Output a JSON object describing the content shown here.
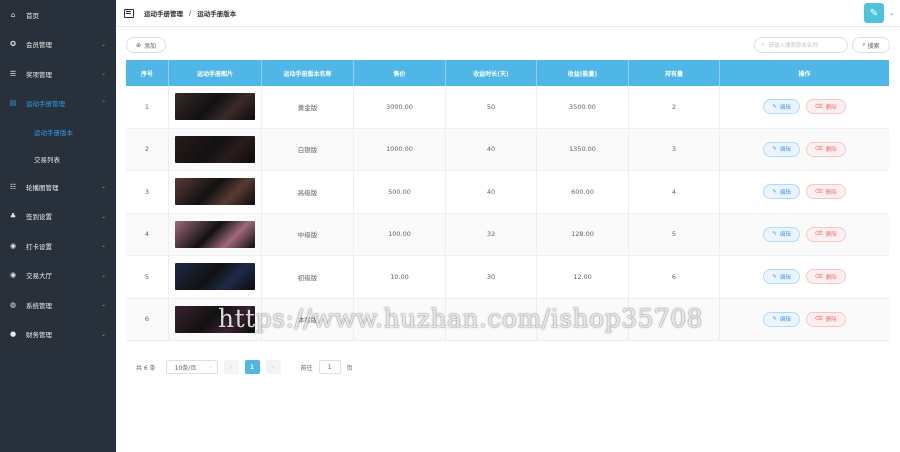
{
  "sidebar": {
    "items": [
      {
        "label": "首页",
        "icon": "home-icon",
        "glyph": "⌂",
        "has_children": false
      },
      {
        "label": "会员管理",
        "icon": "member-icon",
        "glyph": "✪",
        "has_children": true
      },
      {
        "label": "奖项管理",
        "icon": "list-icon",
        "glyph": "☰",
        "has_children": true
      },
      {
        "label": "运动手册管理",
        "icon": "document-icon",
        "glyph": "▤",
        "has_children": true,
        "active": true,
        "children": [
          {
            "label": "运动手册版本",
            "active": true
          },
          {
            "label": "交易列表",
            "active": false
          }
        ]
      },
      {
        "label": "轮播图管理",
        "icon": "carousel-icon",
        "glyph": "☷",
        "has_children": true
      },
      {
        "label": "签到设置",
        "icon": "sitemap-icon",
        "glyph": "♣",
        "has_children": true
      },
      {
        "label": "打卡设置",
        "icon": "checkin-icon",
        "glyph": "◉",
        "has_children": true
      },
      {
        "label": "交易大厅",
        "icon": "hall-icon",
        "glyph": "◉",
        "has_children": true
      },
      {
        "label": "系统管理",
        "icon": "globe-icon",
        "glyph": "◍",
        "has_children": true
      },
      {
        "label": "财务管理",
        "icon": "finance-icon",
        "glyph": "●",
        "has_children": true
      }
    ]
  },
  "topbar": {
    "breadcrumb": [
      "运动手册管理",
      "运动手册版本"
    ],
    "separator": "/"
  },
  "toolbar": {
    "add_label": "添加",
    "search_placeholder": "请输入搜索版本名称",
    "search_label": "搜索"
  },
  "table": {
    "headers": [
      "序号",
      "运动手册图片",
      "运动手册版本名称",
      "售价",
      "收益时长(天)",
      "收益(能量)",
      "持有量",
      "操作"
    ],
    "rows": [
      {
        "index": "1",
        "name": "黄金版",
        "price": "3000.00",
        "days": "50",
        "income": "3500.00",
        "holding": "2",
        "thumb": "#3b2a2a"
      },
      {
        "index": "2",
        "name": "白银版",
        "price": "1000.00",
        "days": "40",
        "income": "1350.00",
        "holding": "3",
        "thumb": "#2a1c1c"
      },
      {
        "index": "3",
        "name": "高级版",
        "price": "500.00",
        "days": "40",
        "income": "600.00",
        "holding": "4",
        "thumb": "#5a3a34"
      },
      {
        "index": "4",
        "name": "中级版",
        "price": "100.00",
        "days": "32",
        "income": "128.00",
        "holding": "5",
        "thumb": "#a06a7a"
      },
      {
        "index": "5",
        "name": "初级版",
        "price": "10.00",
        "days": "30",
        "income": "12.00",
        "holding": "6",
        "thumb": "#1f2a4a"
      },
      {
        "index": "6",
        "name": "体验版",
        "price": "",
        "days": "",
        "income": "",
        "holding": "",
        "thumb": "#3a2230"
      }
    ],
    "edit_label": "编辑",
    "delete_label": "删除"
  },
  "pagination": {
    "total_text": "共 6 条",
    "page_size": "10条/页",
    "prev": "‹",
    "current": "1",
    "next": "›",
    "goto_label": "前往",
    "goto_value": "1",
    "page_suffix": "页"
  },
  "watermark": "https://www.huzhan.com/ishop35708",
  "colors": {
    "sidebar_bg": "#28313b",
    "accent": "#4fb6e8",
    "active_link": "#2f9cf0"
  }
}
